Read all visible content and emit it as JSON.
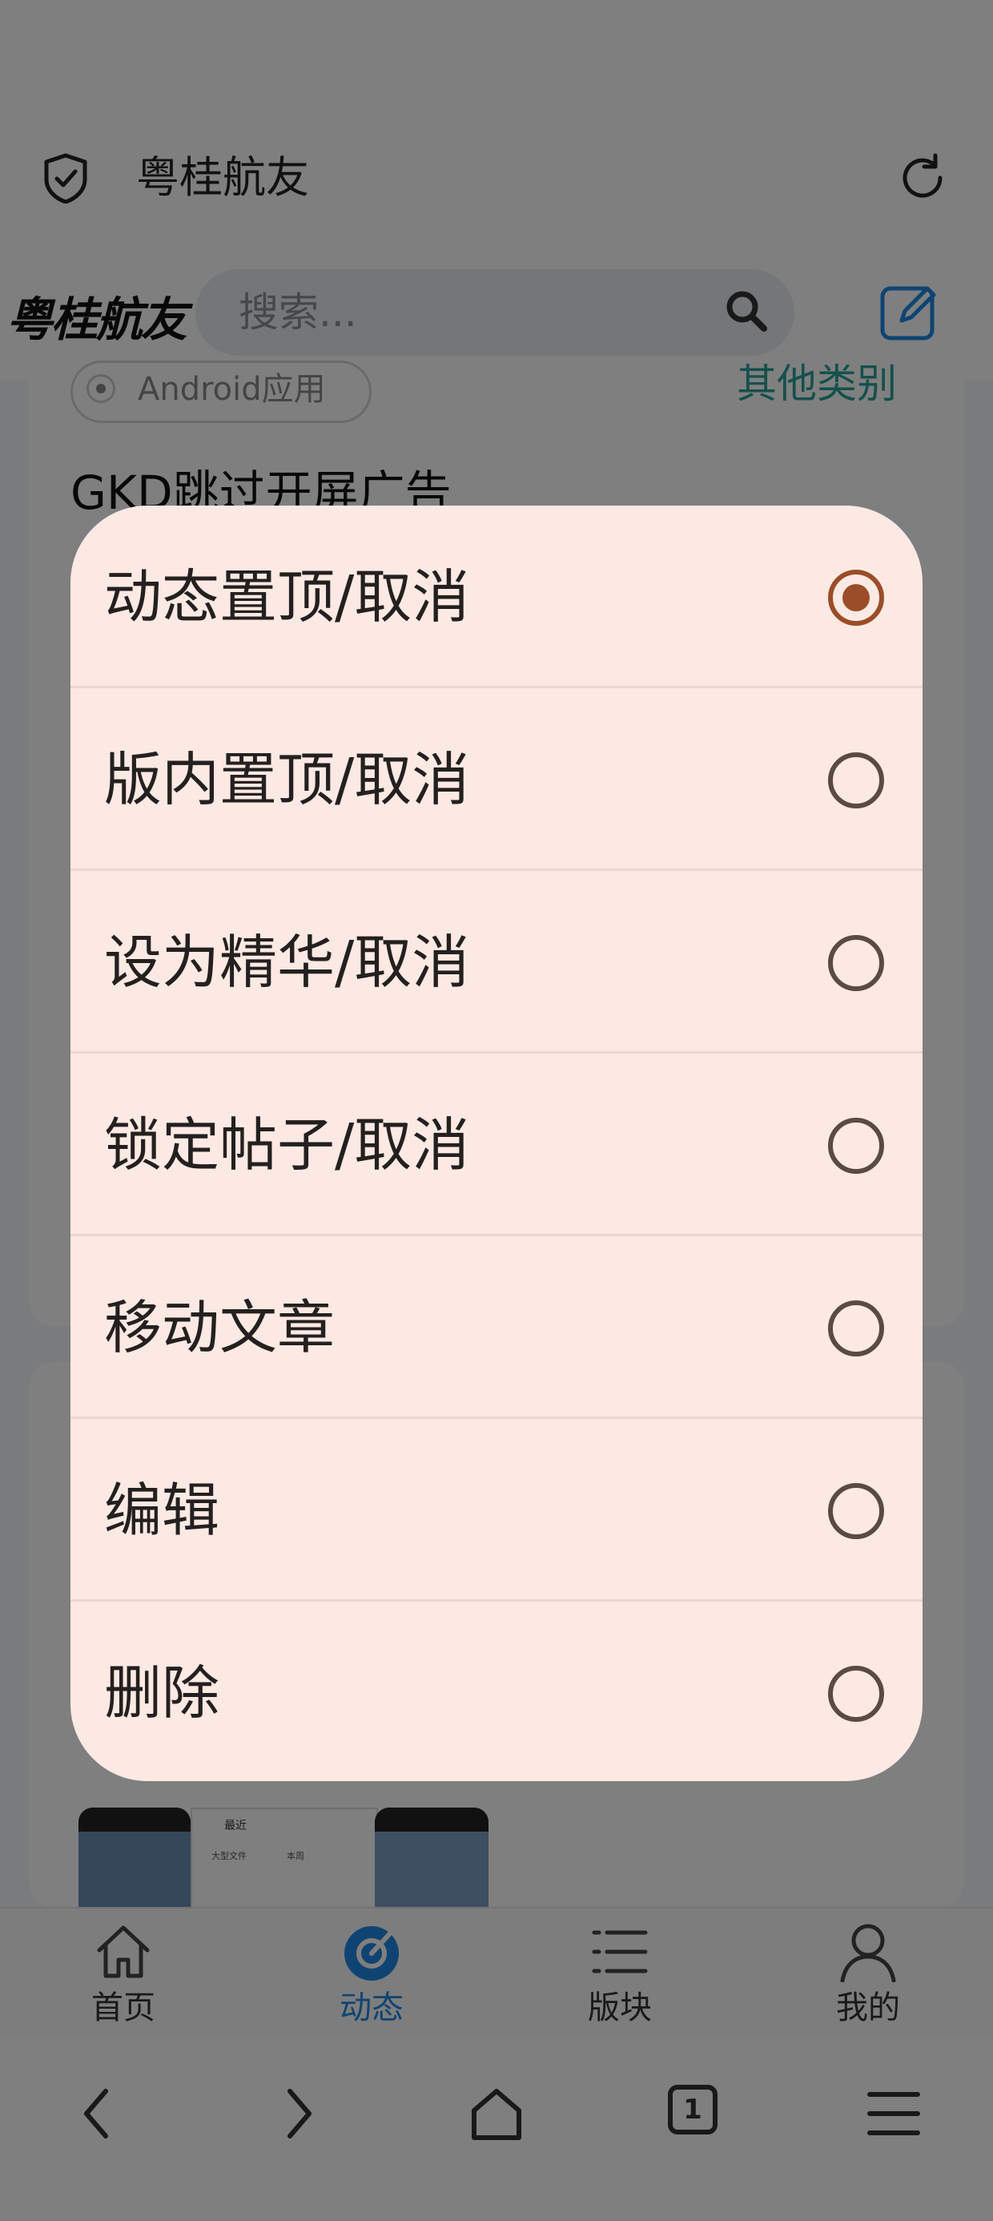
{
  "browser": {
    "site_name": "粤桂航友"
  },
  "header": {
    "logo": "粤桂航友",
    "search_placeholder": "搜索..."
  },
  "post": {
    "category_chip": "Android应用",
    "other_category": "其他类别",
    "title": "GKD跳过开屏广告"
  },
  "thumbnail": {
    "title": "最近",
    "tags": [
      "大型文件",
      "本周"
    ]
  },
  "tabs": [
    {
      "label": "首页",
      "icon": "home-icon"
    },
    {
      "label": "动态",
      "icon": "feed-icon",
      "active": true
    },
    {
      "label": "版块",
      "icon": "list-icon"
    },
    {
      "label": "我的",
      "icon": "user-icon"
    }
  ],
  "system_nav": {
    "tab_count": "1"
  },
  "dialog": {
    "options": [
      {
        "label": "动态置顶/取消",
        "selected": true
      },
      {
        "label": "版内置顶/取消",
        "selected": false
      },
      {
        "label": "设为精华/取消",
        "selected": false
      },
      {
        "label": "锁定帖子/取消",
        "selected": false
      },
      {
        "label": "移动文章",
        "selected": false
      },
      {
        "label": "编辑",
        "selected": false
      },
      {
        "label": "删除",
        "selected": false
      }
    ]
  },
  "colors": {
    "accent": "#9a4d27",
    "dialog_bg": "#fce9e3",
    "tab_active": "#1e88e5",
    "category": "#2aa198"
  }
}
